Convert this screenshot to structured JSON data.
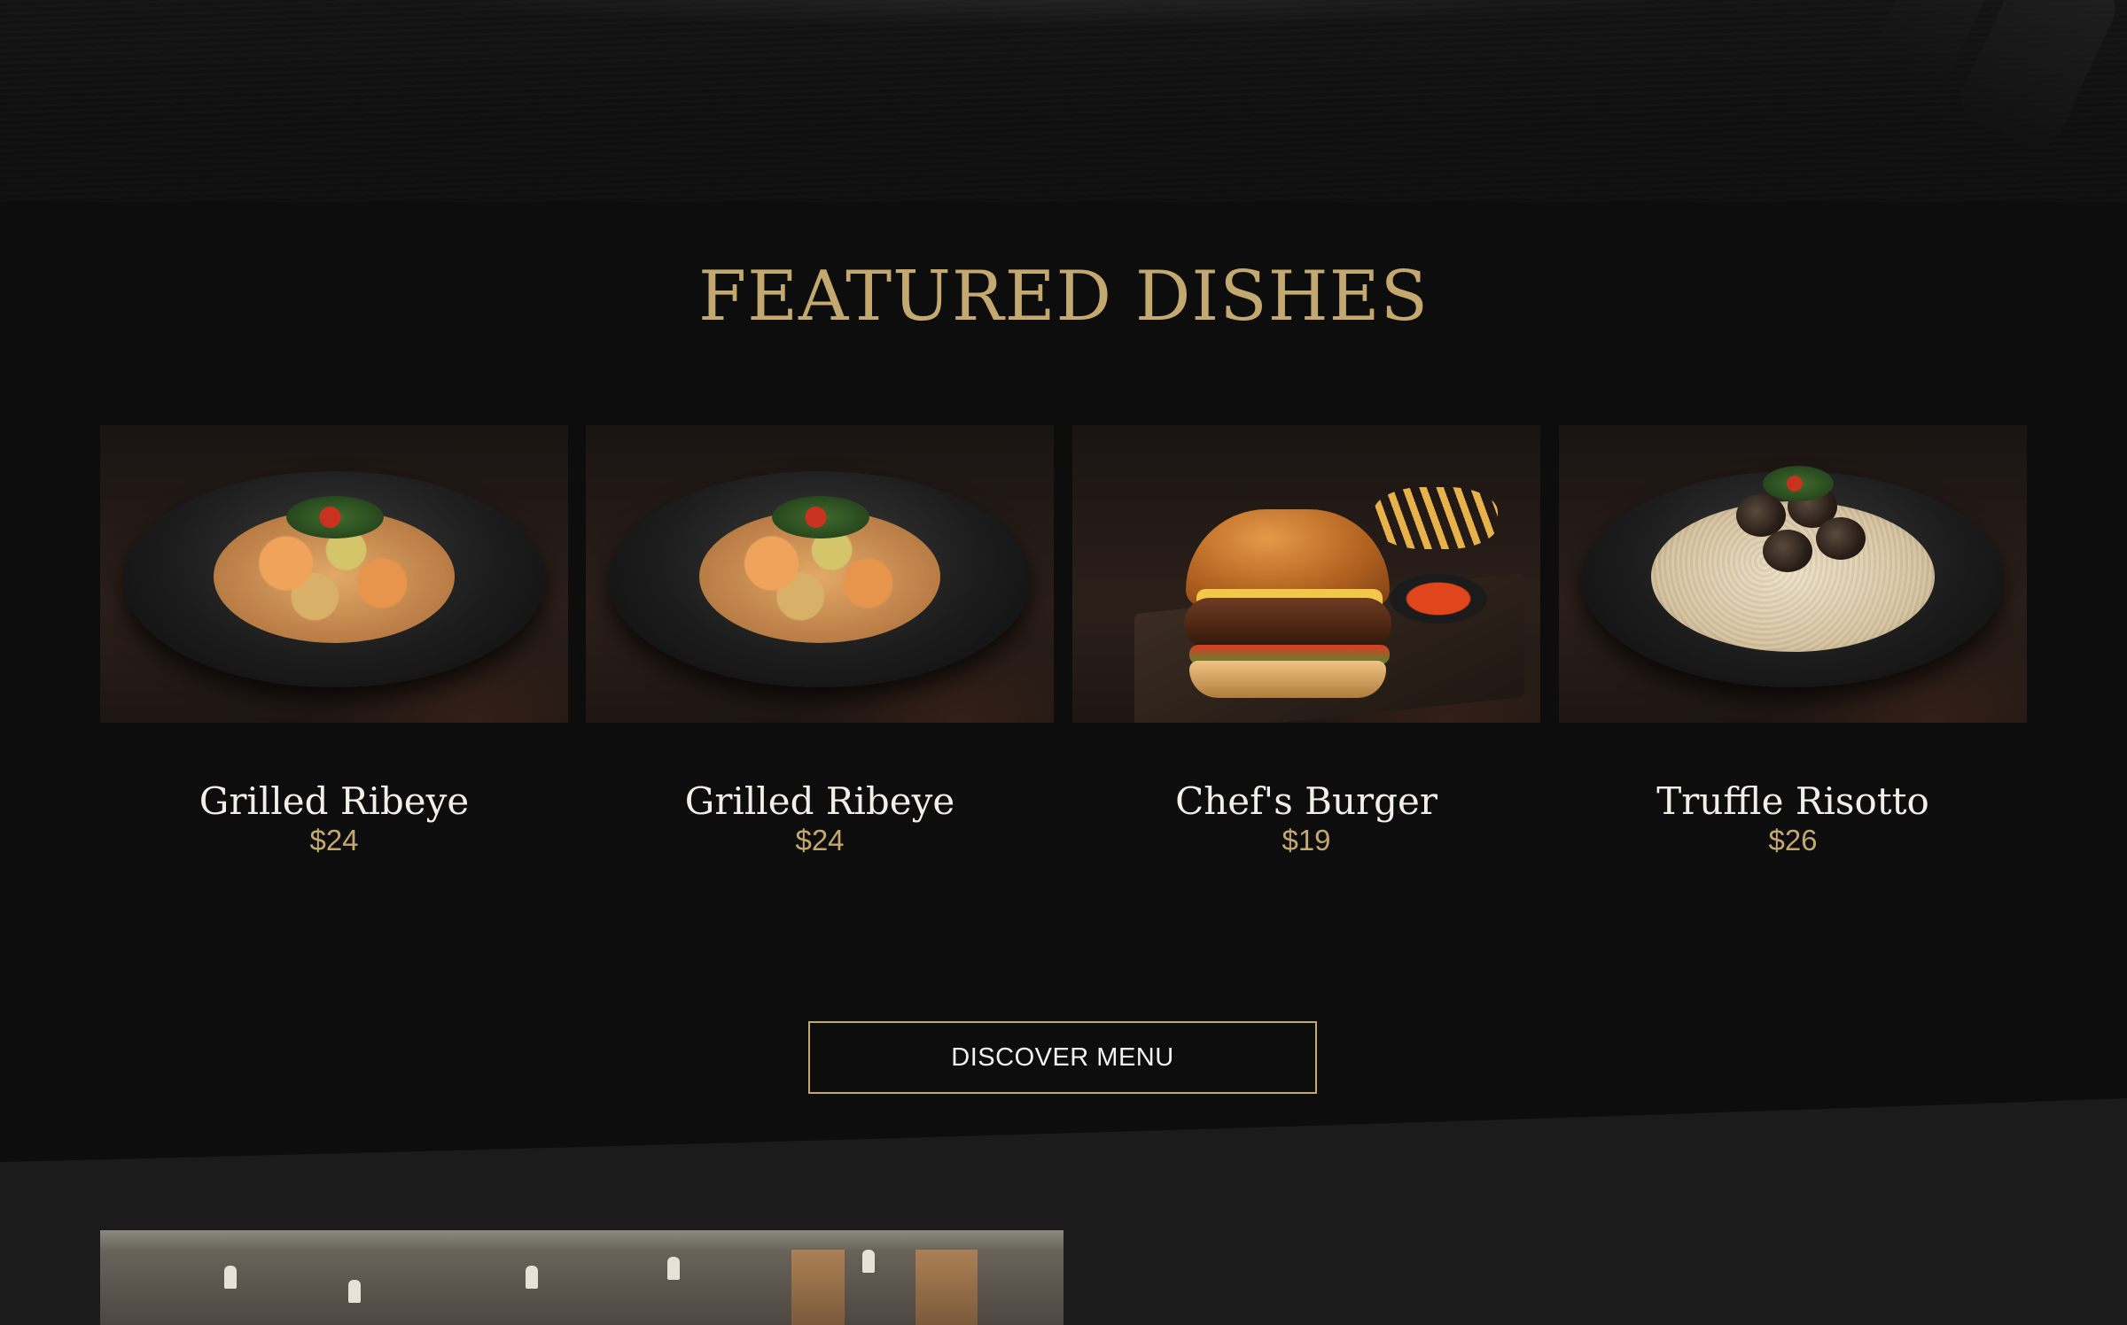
{
  "section": {
    "title": "FEATURED DISHES",
    "cta_label": "DISCOVER MENU"
  },
  "dishes": [
    {
      "name": "Grilled Ribeye",
      "price": "$24",
      "image": "pasta-dish-image"
    },
    {
      "name": "Grilled Ribeye",
      "price": "$24",
      "image": "pasta-dish-image"
    },
    {
      "name": "Chef's Burger",
      "price": "$19",
      "image": "burger-dish-image"
    },
    {
      "name": "Truffle Risotto",
      "price": "$26",
      "image": "risotto-dish-image"
    }
  ],
  "colors": {
    "background": "#0d0d0d",
    "accent_gold": "#c3a870",
    "text_light": "#f2efe8",
    "bottom_section": "#1b1b1b"
  }
}
